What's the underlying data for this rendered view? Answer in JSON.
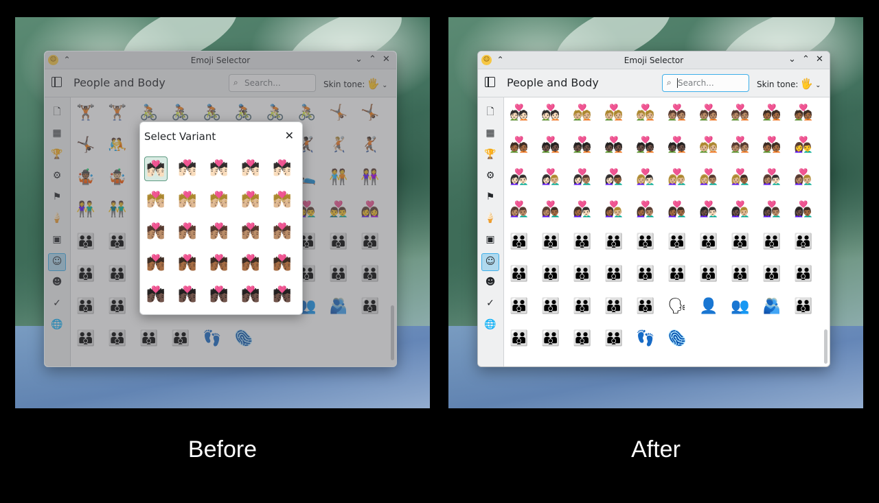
{
  "captions": {
    "before": "Before",
    "after": "After"
  },
  "window": {
    "title": "Emoji Selector",
    "category_title": "People and Body",
    "search_placeholder": "Search...",
    "skin_tone_label": "Skin tone:",
    "skin_tone_glyph": "🖐"
  },
  "sidebar_icons": [
    "recent-icon",
    "grid-icon",
    "trophy-icon",
    "gear-icon",
    "flag-icon",
    "ice-cream-icon",
    "symbols-icon",
    "person-icon",
    "smiley-icon",
    "checkmark-icon",
    "globe-icon"
  ],
  "before": {
    "grid": [
      [
        "🏋🏾",
        "🏋🏽",
        "🚴🏼",
        "🚴🏽",
        "🚴🏾",
        "🚴🏿",
        "🚴🏻",
        "🚴🏼",
        "🤸🏽",
        "🤸🏾"
      ],
      [
        "🤸🏿",
        "🤼",
        "🤾",
        "🤾🏽",
        "🤾🏾",
        "🤽",
        "🤽🏽",
        "🤾🏿",
        "🤾🏼",
        "🤾🏾"
      ],
      [
        "🤹🏾",
        "🤹🏼",
        "🤹🏿",
        "🤹",
        "🛀",
        "🛌",
        "🛌🏽",
        "🛌🏾",
        "🧑‍🤝‍🧑",
        "👭"
      ],
      [
        "👫",
        "👬",
        "👭🏽",
        "👫🏾",
        "👬🏿",
        "💏🏼",
        "💏🏽",
        "👩‍❤️‍👨",
        "👨‍❤️‍👨",
        "👩‍❤️‍👩"
      ],
      [
        "👪",
        "👪",
        "👪",
        "👪",
        "👪",
        "👪",
        "👪",
        "👪",
        "👪",
        "👪"
      ],
      [
        "👪",
        "👪",
        "👪",
        "👪",
        "👪",
        "👪",
        "👪",
        "👪",
        "👪",
        "👪"
      ],
      [
        "👪",
        "👪",
        "👪",
        "👪",
        "👪",
        "🗣",
        "👤",
        "👥",
        "🫂",
        "👪"
      ],
      [
        "👪",
        "👪",
        "👪",
        "👪",
        "👣",
        "🫆"
      ]
    ],
    "dialog": {
      "title": "Select Variant",
      "variants": [
        [
          "💏🏻",
          "💏🏻",
          "💏🏻",
          "💏🏻",
          "💏🏻"
        ],
        [
          "💏🏼",
          "💏🏼",
          "💏🏼",
          "💏🏼",
          "💏🏼"
        ],
        [
          "💏🏽",
          "💏🏽",
          "💏🏽",
          "💏🏽",
          "💏🏽"
        ],
        [
          "💏🏾",
          "💏🏾",
          "💏🏾",
          "💏🏾",
          "💏🏾"
        ],
        [
          "💏🏿",
          "💏🏿",
          "💏🏿",
          "💏🏿",
          "💏🏿"
        ]
      ]
    }
  },
  "after": {
    "grid": [
      [
        "💑🏻",
        "💑🏻",
        "💑🏼",
        "💑🏼",
        "💑🏼",
        "💑🏽",
        "💑🏽",
        "💑🏽",
        "💑🏾",
        "💑🏾"
      ],
      [
        "💑🏾",
        "💑🏿",
        "💑🏿",
        "💑🏿",
        "💑🏿",
        "💑🏿",
        "💑🏼",
        "💑🏽",
        "💑🏾",
        "👩‍❤️‍👨"
      ],
      [
        "👩🏻‍❤️‍👨🏻",
        "👩🏻‍❤️‍👨🏼",
        "👩🏻‍❤️‍👨🏽",
        "👩🏻‍❤️‍👨🏾",
        "👩🏼‍❤️‍👨🏻",
        "👩🏼‍❤️‍👨🏼",
        "👩🏼‍❤️‍👨🏽",
        "👩🏼‍❤️‍👨🏾",
        "👩🏽‍❤️‍👨🏻",
        "👩🏽‍❤️‍👨🏼"
      ],
      [
        "👩🏽‍❤️‍👨🏽",
        "👩🏽‍❤️‍👨🏾",
        "👩🏾‍❤️‍👨🏻",
        "👩🏾‍❤️‍👨🏼",
        "👩🏾‍❤️‍👨🏽",
        "👩🏾‍❤️‍👨🏾",
        "👩🏿‍❤️‍👨🏻",
        "👩🏿‍❤️‍👨🏼",
        "👩🏿‍❤️‍👨🏽",
        "👩🏿‍❤️‍👨🏾"
      ],
      [
        "👪",
        "👪",
        "👪",
        "👪",
        "👪",
        "👪",
        "👪",
        "👪",
        "👪",
        "👪"
      ],
      [
        "👪",
        "👪",
        "👪",
        "👪",
        "👪",
        "👪",
        "👪",
        "👪",
        "👪",
        "👪"
      ],
      [
        "👪",
        "👪",
        "👪",
        "👪",
        "👪",
        "🗣",
        "👤",
        "👥",
        "🫂",
        "👪"
      ],
      [
        "👪",
        "👪",
        "👪",
        "👪",
        "👣",
        "🫆"
      ]
    ]
  }
}
